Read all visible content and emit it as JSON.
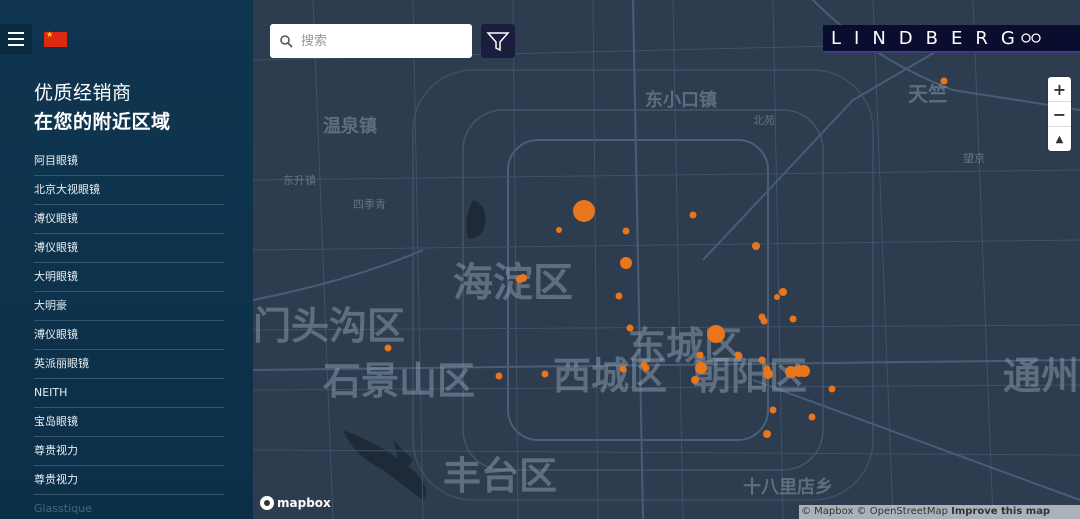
{
  "sidebar": {
    "heading_line1": "优质经销商",
    "heading_line2": "在您的附近区域",
    "dealers": [
      "阿目眼镜",
      "北京大视眼镜",
      "溥仪眼镜",
      "溥仪眼镜",
      "大明眼镜",
      "大明豪",
      "溥仪眼镜",
      "英派丽眼镜",
      "NEITH",
      "宝岛眼镜",
      "尊贵视力",
      "尊贵视力",
      "Glasstique"
    ]
  },
  "search": {
    "placeholder": "搜索"
  },
  "brand": {
    "name": "LINDBERG"
  },
  "zoom": {
    "in": "+",
    "out": "−",
    "north": "▲"
  },
  "map": {
    "places_large": [
      {
        "name": "海淀区"
      },
      {
        "name": "石景山区"
      },
      {
        "name": "西城区"
      },
      {
        "name": "东城区"
      },
      {
        "name": "朝阳区"
      },
      {
        "name": "丰台区"
      },
      {
        "name": "通州"
      },
      {
        "name": "门头沟区"
      }
    ],
    "places_small": [
      {
        "name": "温泉镇"
      },
      {
        "name": "东小口镇"
      },
      {
        "name": "天竺"
      },
      {
        "name": "十八里店乡"
      },
      {
        "name": "东升镇"
      },
      {
        "name": "北苑"
      },
      {
        "name": "望京"
      },
      {
        "name": "四季青"
      }
    ],
    "dealer_markers_count": 38
  },
  "logo": {
    "text": "mapbox"
  },
  "attribution": {
    "mapbox": "© Mapbox",
    "osm": "© OpenStreetMap",
    "improve": "Improve this map"
  }
}
